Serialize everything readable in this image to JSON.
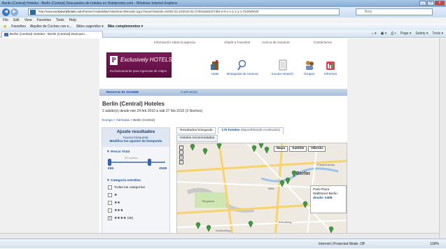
{
  "window": {
    "title": "Berlin (Central) Hoteles - Berlin (Central) Descuentos de hoteles en Hotelpronto.com - Windows Internet Explorer",
    "min": "_",
    "max": "□",
    "close": "x"
  },
  "addressbar": {
    "url_prefix": "http://www.",
    "url_domain": "exclusivelyhotels.com",
    "url_rest": "/Partner/Availability/HotelSearchResults.aspx?SearchDetails=S2002.02.24/2010.02.27/9/4228/2/2/7/8/2-0-0-1-1-1-1-1-1-72/2/9/0/4/0",
    "search_placeholder": "Bing"
  },
  "menubar": [
    "File",
    "Edit",
    "View",
    "Favorites",
    "Tools",
    "Help"
  ],
  "favbar": {
    "favorites": "Favorites",
    "item1": "Alquiler de Coches con e...",
    "item2": "Sitios sugeridos ▾",
    "item3": "Más complementos ▾"
  },
  "tab": {
    "label": "Berlin (Central) Hoteles - Berlin (Central) Descuen..."
  },
  "commandbar": [
    "Page ▾",
    "Safety ▾",
    "Tools ▾"
  ],
  "site": {
    "topmenu": {
      "info": "Información sobre la agencia",
      "fav": "Añadir a Favoritos",
      "about": "Acerca de nosotros",
      "contact": "Contáctenos"
    },
    "logo": {
      "letter": "P",
      "name": "Exclusively HOTELS",
      "tagline": "Exclusivamente para Agencias de Viajes"
    },
    "nav": [
      {
        "label": "Hotel"
      },
      {
        "label": "Búsqueda de reserva"
      },
      {
        "label": "Invoice Search"
      },
      {
        "label": "Grupos"
      },
      {
        "label": "Informes"
      }
    ],
    "reserv": {
      "label": "Reservas  91 4141845",
      "cart": "0 artículo(s)"
    },
    "heading": "Berlin (Central)  Hoteles",
    "subheading": "2 adulto(s) desde mié 24 feb 2010 a sáb 27 feb 2010 (3 Noches)",
    "breadcrumb": {
      "a": "Europa",
      "b": "Alemania",
      "c": "Berlin (Central)"
    },
    "sidebar": {
      "title": "Ajuste resultados",
      "new_search": "Nueva búsqueda",
      "modify": "Modifica los ajustes de búsqueda",
      "price_label": "▼ Precio Total",
      "mid_label": "30 noches",
      "price_min": "€59",
      "price_max": "€538",
      "cat_label": "▼ Categoría estrellas",
      "categories": [
        {
          "label": "Todas las categorías",
          "checked": ""
        },
        {
          "label": "★",
          "checked": ""
        },
        {
          "label": "★★",
          "checked": ""
        },
        {
          "label": "★★★",
          "checked": ""
        },
        {
          "label": "★★★★  (39)",
          "checked": "✓"
        }
      ]
    },
    "results_tabs": {
      "tab1": "Resultados búsqueda",
      "tab2_count": "170 hoteles",
      "tab2_rest": "disponibles(30 mostrados)",
      "tab3": "Hoteles recomendados"
    },
    "map": {
      "types": [
        "Mapa",
        "Satélite",
        "Híbrido"
      ],
      "city": "Berlin",
      "popup_name": "Park Plaza Wallstreet Berlin",
      "popup_price": "desde: €408",
      "labels": [
        "Tiergarten",
        "Kreuzberg",
        "Mitte",
        "Friedrichshain",
        "Schöneberg"
      ]
    }
  },
  "statusbar": {
    "zone": "Internet | Protected Mode: Off",
    "zoom": "100%"
  }
}
